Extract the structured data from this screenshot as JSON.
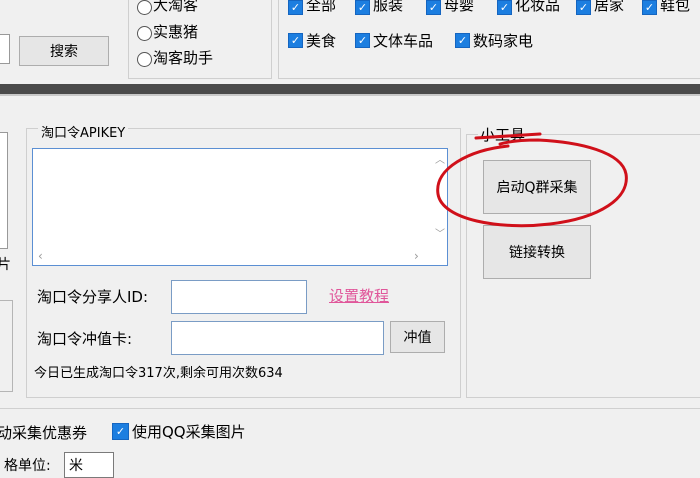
{
  "top": {
    "search_button": "搜索",
    "radios": [
      "大淘客",
      "实惠猪",
      "淘客助手"
    ],
    "categories_row1": [
      "全部",
      "服装",
      "母婴",
      "化妆品",
      "居家",
      "鞋包"
    ],
    "categories_row2": [
      "美食",
      "文体车品",
      "数码家电"
    ]
  },
  "taokouling": {
    "group_title": "淘口令APIKEY",
    "sharer_id_label": "淘口令分享人ID:",
    "setup_link": "设置教程",
    "recharge_label": "淘口令冲值卡:",
    "recharge_button": "冲值",
    "status": "今日已生成淘口令317次,剩余可用次数634"
  },
  "tools": {
    "title": "小工具",
    "start_qq_collect": "启动Q群采集",
    "link_convert": "链接转换"
  },
  "bottom": {
    "coupon_label": "动采集优惠券",
    "use_qq_images": "使用QQ采集图片",
    "price_unit_label": "格单位:",
    "price_unit_value": "米"
  },
  "colors": {
    "accent": "#1c7ee0",
    "link": "#e0569a",
    "annotation": "#d0101a"
  }
}
